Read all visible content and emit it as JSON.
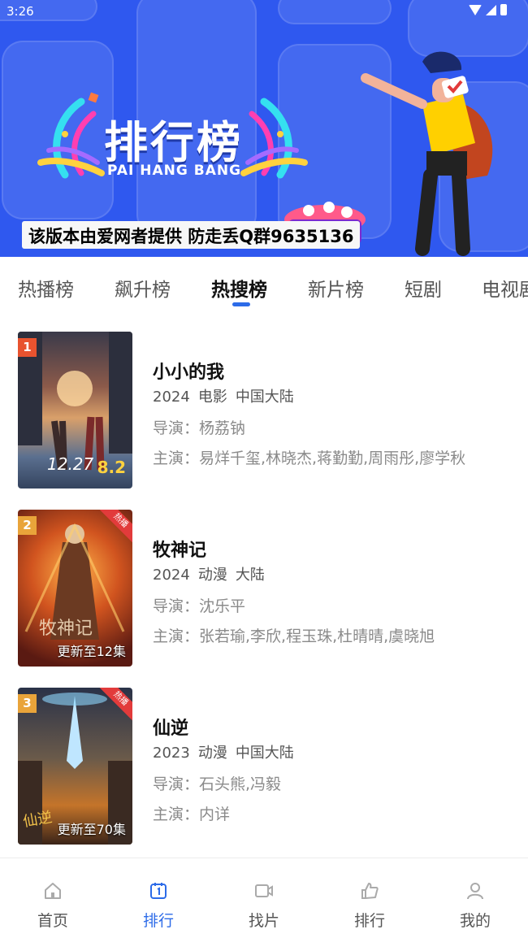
{
  "status_bar": {
    "time": "3:26"
  },
  "banner": {
    "logo_title": "排行榜",
    "logo_subtitle": "PAI HANG BANG",
    "notice": "该版本由爱网者提供 防走丢Q群9635136"
  },
  "tabs": [
    {
      "label": "热播榜"
    },
    {
      "label": "飙升榜"
    },
    {
      "label": "热搜榜"
    },
    {
      "label": "新片榜"
    },
    {
      "label": "短剧"
    },
    {
      "label": "电视剧"
    }
  ],
  "active_tab": "热搜榜",
  "items": [
    {
      "rank": "1",
      "rank_color": "#e8532f",
      "title": "小小的我",
      "year": "2024",
      "type": "电影",
      "region": "中国大陆",
      "director": "导演：杨荔钠",
      "cast": "主演：易烊千玺,林晓杰,蒋勤勤,周雨彤,廖学秋",
      "poster_text": "12.27",
      "poster_rating": "8.2"
    },
    {
      "rank": "2",
      "rank_color": "#e9a43a",
      "title": "牧神记",
      "year": "2024",
      "type": "动漫",
      "region": "大陆",
      "director": "导演：沈乐平",
      "cast": "主演：张若瑜,李欣,程玉珠,杜晴晴,虞晓旭",
      "badge": "热播",
      "update": "更新至12集",
      "poster_text": "牧神记"
    },
    {
      "rank": "3",
      "rank_color": "#e9a43a",
      "title": "仙逆",
      "year": "2023",
      "type": "动漫",
      "region": "中国大陆",
      "director": "导演：石头熊,冯毅",
      "cast": "主演：内详",
      "badge": "热播",
      "update": "更新至70集",
      "poster_text": "仙逆"
    }
  ],
  "bottom_nav": [
    {
      "label": "首页",
      "icon": "home-icon"
    },
    {
      "label": "排行",
      "icon": "ranking-icon",
      "active": true
    },
    {
      "label": "找片",
      "icon": "video-camera-icon"
    },
    {
      "label": "排行",
      "icon": "thumbs-up-icon"
    },
    {
      "label": "我的",
      "icon": "user-icon"
    }
  ],
  "colors": {
    "accent": "#2c6be8",
    "banner": "#2f58ef",
    "hot_badge": "#e23b3b"
  }
}
